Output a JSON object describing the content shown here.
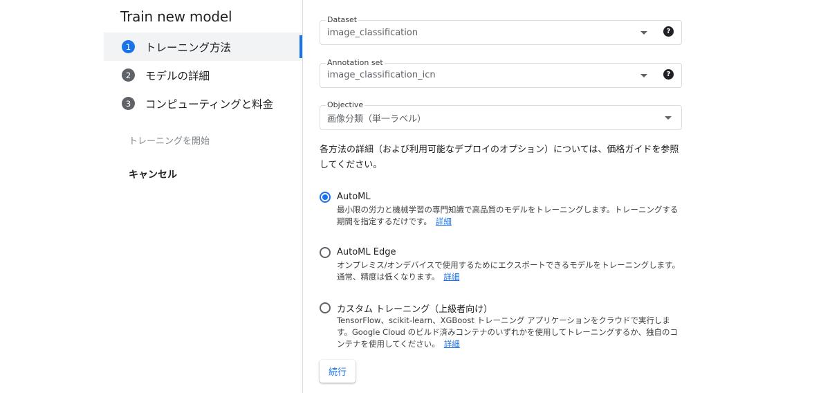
{
  "panel": {
    "title": "Train new model",
    "steps": [
      {
        "number": "1",
        "label": "トレーニング方法",
        "active": true
      },
      {
        "number": "2",
        "label": "モデルの詳細",
        "active": false
      },
      {
        "number": "3",
        "label": "コンピューティングと料金",
        "active": false
      }
    ],
    "start_training": "トレーニングを開始",
    "cancel": "キャンセル"
  },
  "form": {
    "dataset": {
      "label": "Dataset",
      "value": "image_classification"
    },
    "annotation_set": {
      "label": "Annotation set",
      "value": "image_classification_icn"
    },
    "objective": {
      "label": "Objective",
      "value": "画像分類（単一ラベル）"
    },
    "description": "各方法の詳細（および利用可能なデプロイのオプション）については、価格ガイドを参照してください。",
    "options": [
      {
        "title": "AutoML",
        "description": "最小限の労力と機械学習の専門知識で高品質のモデルをトレーニングします。トレーニングする期間を指定するだけです。",
        "link": "詳細",
        "selected": true
      },
      {
        "title": "AutoML Edge",
        "description": "オンプレミス/オンデバイスで使用するためにエクスポートできるモデルをトレーニングします。通常、精度は低くなります。",
        "link": "詳細",
        "selected": false
      },
      {
        "title": "カスタム トレーニング（上級者向け）",
        "description": "TensorFlow、scikit-learn、XGBoost トレーニング アプリケーションをクラウドで実行します。Google Cloud のビルド済みコンテナのいずれかを使用してトレーニングするか、独自のコンテナを使用してください。",
        "link": "詳細",
        "selected": false
      }
    ],
    "help_glyph": "?",
    "continue_label": "続行"
  },
  "colors": {
    "accent": "#1a73e8",
    "text": "#202124",
    "muted": "#5f6368"
  }
}
